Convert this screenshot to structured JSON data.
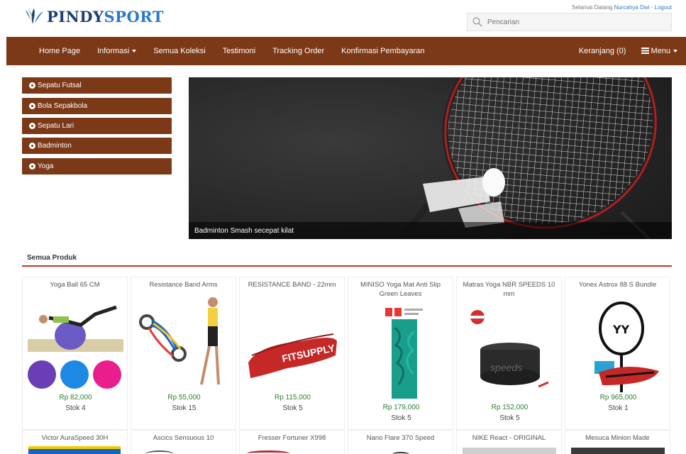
{
  "header": {
    "logo_prefix": "PINDY",
    "logo_suffix": "SPORT",
    "welcome_prefix": "Selamat Datang",
    "welcome_user": "Nurcahya Dwi - Logout",
    "search_placeholder": "Pencarian"
  },
  "nav": {
    "items": [
      "Home Page",
      "Informasi",
      "Semua Koleksi",
      "Testimoni",
      "Tracking Order",
      "Konfirmasi Pembayaran"
    ],
    "cart": "Keranjang (0)",
    "menu": "Menu"
  },
  "categories": [
    "Sepatu Futsal",
    "Bola Sepakbola",
    "Sepatu Lari",
    "Badminton",
    "Yoga"
  ],
  "banner": {
    "caption": "Badminton Smash secepat kilat"
  },
  "section": {
    "title": "Semua Produk"
  },
  "products": [
    {
      "name": "Yoga Ball 65 CM",
      "price": "Rp 82,000",
      "stock": "Stok 4"
    },
    {
      "name": "Resistance Band Arms",
      "price": "Rp 55,000",
      "stock": "Stok 15"
    },
    {
      "name": "RESISTANCE BAND - 22mm",
      "price": "Rp 115,000",
      "stock": "Stok 5"
    },
    {
      "name": "MINISO Yoga Mat Anti Slip Green Leaves",
      "price": "Rp 179,000",
      "stock": "Stok 5"
    },
    {
      "name": "Matras Yoga NBR SPEEDS 10 mm",
      "price": "Rp 152,000",
      "stock": "Stok 5"
    },
    {
      "name": "Yonex Astrox 88 S Bundle",
      "price": "Rp 965,000",
      "stock": "Stok 1"
    },
    {
      "name": "Victor AuraSpeed 30H",
      "price": "",
      "stock": ""
    },
    {
      "name": "Ascics Sensuous 10",
      "price": "",
      "stock": ""
    },
    {
      "name": "Fresser Fortuner X998",
      "price": "",
      "stock": ""
    },
    {
      "name": "Nano Flare 370 Speed",
      "price": "",
      "stock": ""
    },
    {
      "name": "NIKE React - ORIGINAL",
      "price": "",
      "stock": ""
    },
    {
      "name": "Mesuca Minion Made",
      "price": "",
      "stock": ""
    }
  ],
  "colors": {
    "nav_brown": "#7b3917",
    "accent_red": "#c0392b",
    "price_green": "#2e7d32",
    "logo_dark_blue": "#1f3f77",
    "logo_blue": "#2a78c9"
  }
}
